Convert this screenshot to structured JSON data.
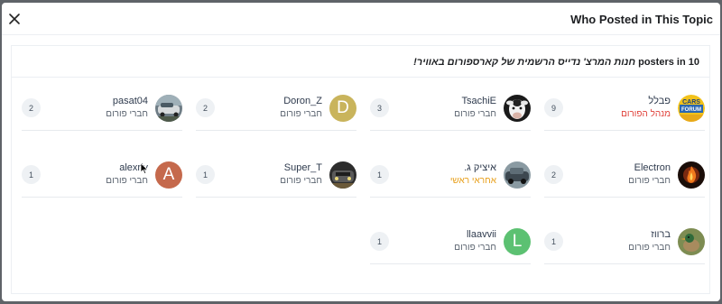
{
  "modal": {
    "title": "Who Posted in This Topic",
    "subtitle_prefix": "10 posters in",
    "topic": "חנות המרצ' נדייס הרשמית של קארספורום באוויר!"
  },
  "colors": {
    "admin_role": "#e0413a",
    "senior_role": "#e8a01c"
  },
  "posters": [
    {
      "name": "פבלל",
      "role": "מנהל הפורום",
      "role_type": "admin",
      "count": "9",
      "avatar": "cars-forum-logo"
    },
    {
      "name": "TsachiE",
      "role": "חברי פורום",
      "role_type": "member",
      "count": "3",
      "avatar": "cow-photo"
    },
    {
      "name": "Doron_Z",
      "role": "חברי פורום",
      "role_type": "member",
      "count": "2",
      "avatar_letter": "D",
      "avatar_color": "#c9b45c"
    },
    {
      "name": "pasat04",
      "role": "חברי פורום",
      "role_type": "member",
      "count": "2",
      "avatar": "car-photo-silver"
    },
    {
      "name": "Electron",
      "role": "חברי פורום",
      "role_type": "member",
      "count": "2",
      "avatar": "fire-photo"
    },
    {
      "name": "איציק ג.",
      "role": "אחראי ראשי",
      "role_type": "senior",
      "count": "1",
      "avatar": "car-photo-dark"
    },
    {
      "name": "Super_T",
      "role": "חברי פורום",
      "role_type": "member",
      "count": "1",
      "avatar": "car-photo-front"
    },
    {
      "name": "alexriv",
      "role": "חברי פורום",
      "role_type": "member",
      "count": "1",
      "avatar_letter": "A",
      "avatar_color": "#c5694c"
    },
    {
      "name": "ברווז",
      "role": "חברי פורום",
      "role_type": "member",
      "count": "1",
      "avatar": "duck-photo"
    },
    {
      "name": "llaavvii",
      "role": "חברי פורום",
      "role_type": "member",
      "count": "1",
      "avatar_letter": "L",
      "avatar_color": "#5cc172"
    }
  ]
}
